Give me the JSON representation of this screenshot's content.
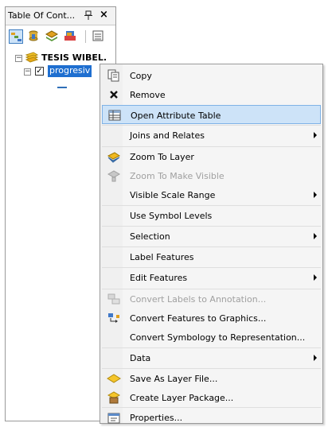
{
  "toc": {
    "title": "Table Of Cont...",
    "pin_glyph": "(",
    "close_glyph": "×",
    "dataframe_label": "TESIS WIBEL.",
    "layer_label": "progresiv",
    "toolbar_icons": [
      "list-by-drawing-order-icon",
      "list-by-source-icon",
      "list-by-visibility-icon",
      "list-by-selection-icon",
      "options-icon"
    ]
  },
  "menu": {
    "items": [
      {
        "label": "Copy",
        "icon": "copy-icon",
        "disabled": false,
        "submenu": false,
        "sep": false
      },
      {
        "label": "Remove",
        "icon": "remove-icon",
        "disabled": false,
        "submenu": false,
        "sep": false
      },
      {
        "label": "Open Attribute Table",
        "icon": "table-icon",
        "disabled": false,
        "submenu": false,
        "sep": true,
        "hover": true
      },
      {
        "label": "Joins and Relates",
        "icon": "",
        "disabled": false,
        "submenu": true,
        "sep": true
      },
      {
        "label": "Zoom To Layer",
        "icon": "zoom-to-layer-icon",
        "disabled": false,
        "submenu": false,
        "sep": true
      },
      {
        "label": "Zoom To Make Visible",
        "icon": "zoom-to-visible-icon",
        "disabled": true,
        "submenu": false,
        "sep": false
      },
      {
        "label": "Visible Scale Range",
        "icon": "",
        "disabled": false,
        "submenu": true,
        "sep": false
      },
      {
        "label": "Use Symbol Levels",
        "icon": "",
        "disabled": false,
        "submenu": false,
        "sep": true
      },
      {
        "label": "Selection",
        "icon": "",
        "disabled": false,
        "submenu": true,
        "sep": true
      },
      {
        "label": "Label Features",
        "icon": "",
        "disabled": false,
        "submenu": false,
        "sep": true
      },
      {
        "label": "Edit Features",
        "icon": "",
        "disabled": false,
        "submenu": true,
        "sep": true
      },
      {
        "label": "Convert Labels to Annotation...",
        "icon": "convert-labels-icon",
        "disabled": true,
        "submenu": false,
        "sep": true
      },
      {
        "label": "Convert Features to Graphics...",
        "icon": "convert-graphics-icon",
        "disabled": false,
        "submenu": false,
        "sep": false
      },
      {
        "label": "Convert Symbology to Representation...",
        "icon": "",
        "disabled": false,
        "submenu": false,
        "sep": false
      },
      {
        "label": "Data",
        "icon": "",
        "disabled": false,
        "submenu": true,
        "sep": true
      },
      {
        "label": "Save As Layer File...",
        "icon": "layer-file-icon",
        "disabled": false,
        "submenu": false,
        "sep": true
      },
      {
        "label": "Create Layer Package...",
        "icon": "layer-package-icon",
        "disabled": false,
        "submenu": false,
        "sep": false
      },
      {
        "label": "Properties...",
        "icon": "properties-icon",
        "disabled": false,
        "submenu": false,
        "sep": true
      }
    ]
  }
}
